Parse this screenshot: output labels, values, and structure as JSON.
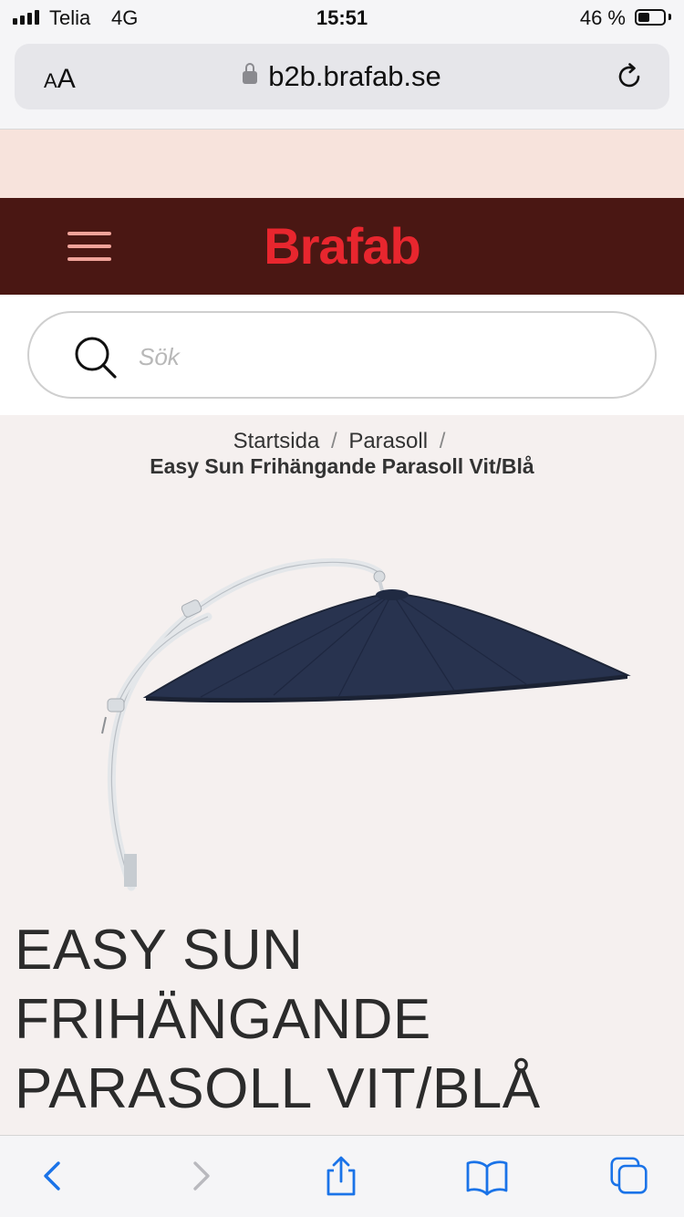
{
  "status_bar": {
    "carrier": "Telia",
    "network": "4G",
    "time": "15:51",
    "battery_percent": "46 %",
    "battery_level": 0.46
  },
  "browser": {
    "text_size_label": "AA",
    "url": "b2b.brafab.se"
  },
  "header": {
    "logo": "Brafab"
  },
  "search": {
    "placeholder": "Sök"
  },
  "breadcrumb": {
    "items": [
      "Startsida",
      "Parasoll"
    ],
    "separator": "/",
    "current": "Easy Sun Frihängande Parasoll Vit/Blå"
  },
  "product": {
    "title": "EASY SUN FRIHÄNGANDE PARASOLL VIT/BLÅ"
  },
  "colors": {
    "header_bg": "#4a1713",
    "logo": "#e8262e",
    "promo_strip": "#f7e3dc",
    "safari_blue": "#1a73e8",
    "canopy": "#28334f"
  },
  "icons": [
    "signal-icon",
    "lock-icon",
    "reload-icon",
    "menu-icon",
    "search-icon",
    "back-icon",
    "forward-icon",
    "share-icon",
    "bookmarks-icon",
    "tabs-icon"
  ]
}
